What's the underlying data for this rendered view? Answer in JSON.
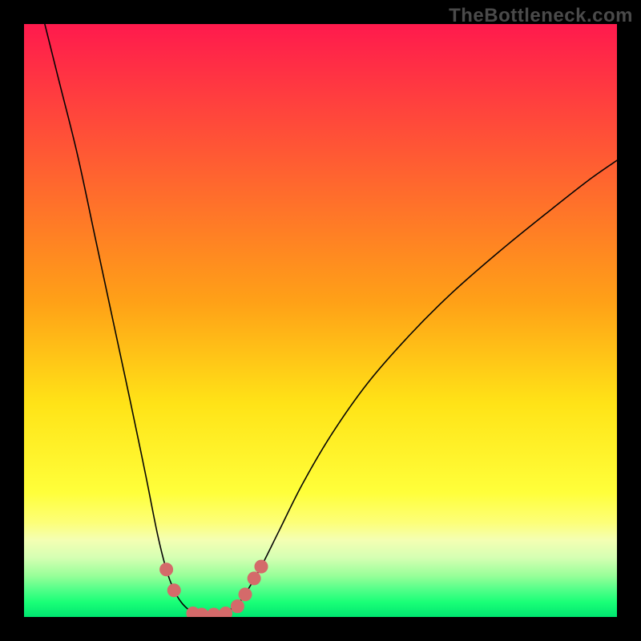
{
  "watermark": "TheBottleneck.com",
  "colors": {
    "frame_bg": "#000000",
    "watermark": "#4a4a4a",
    "curve": "#050505",
    "curve_stroke_w": 1.6,
    "marker_fill": "#d46a6a",
    "marker_stroke": "#d46a6a",
    "gradient_stops": [
      {
        "offset": 0.0,
        "color": "#ff1a4d"
      },
      {
        "offset": 0.47,
        "color": "#ffa117"
      },
      {
        "offset": 0.64,
        "color": "#ffe317"
      },
      {
        "offset": 0.79,
        "color": "#ffff3a"
      },
      {
        "offset": 0.84,
        "color": "#fdff77"
      },
      {
        "offset": 0.87,
        "color": "#f4ffb3"
      },
      {
        "offset": 0.9,
        "color": "#d5ffb3"
      },
      {
        "offset": 0.93,
        "color": "#99ff99"
      },
      {
        "offset": 0.955,
        "color": "#4fff88"
      },
      {
        "offset": 0.975,
        "color": "#1aff77"
      },
      {
        "offset": 1.0,
        "color": "#00e670"
      }
    ]
  },
  "chart_data": {
    "type": "line",
    "title": "",
    "xlabel": "",
    "ylabel": "",
    "xlim": [
      0,
      1
    ],
    "ylim": [
      0,
      1
    ],
    "curve": [
      {
        "x": 0.035,
        "y": 1.0
      },
      {
        "x": 0.06,
        "y": 0.9
      },
      {
        "x": 0.09,
        "y": 0.78
      },
      {
        "x": 0.12,
        "y": 0.64
      },
      {
        "x": 0.15,
        "y": 0.5
      },
      {
        "x": 0.18,
        "y": 0.36
      },
      {
        "x": 0.205,
        "y": 0.24
      },
      {
        "x": 0.225,
        "y": 0.14
      },
      {
        "x": 0.24,
        "y": 0.08
      },
      {
        "x": 0.253,
        "y": 0.045
      },
      {
        "x": 0.265,
        "y": 0.025
      },
      {
        "x": 0.278,
        "y": 0.012
      },
      {
        "x": 0.29,
        "y": 0.006
      },
      {
        "x": 0.305,
        "y": 0.004
      },
      {
        "x": 0.32,
        "y": 0.004
      },
      {
        "x": 0.335,
        "y": 0.007
      },
      {
        "x": 0.35,
        "y": 0.014
      },
      {
        "x": 0.365,
        "y": 0.027
      },
      {
        "x": 0.38,
        "y": 0.05
      },
      {
        "x": 0.4,
        "y": 0.085
      },
      {
        "x": 0.43,
        "y": 0.145
      },
      {
        "x": 0.47,
        "y": 0.225
      },
      {
        "x": 0.52,
        "y": 0.31
      },
      {
        "x": 0.58,
        "y": 0.395
      },
      {
        "x": 0.65,
        "y": 0.475
      },
      {
        "x": 0.72,
        "y": 0.545
      },
      {
        "x": 0.8,
        "y": 0.615
      },
      {
        "x": 0.88,
        "y": 0.68
      },
      {
        "x": 0.95,
        "y": 0.735
      },
      {
        "x": 1.0,
        "y": 0.77
      }
    ],
    "markers": [
      {
        "x": 0.24,
        "y": 0.08
      },
      {
        "x": 0.253,
        "y": 0.045
      },
      {
        "x": 0.285,
        "y": 0.006
      },
      {
        "x": 0.3,
        "y": 0.004
      },
      {
        "x": 0.32,
        "y": 0.004
      },
      {
        "x": 0.34,
        "y": 0.006
      },
      {
        "x": 0.36,
        "y": 0.018
      },
      {
        "x": 0.373,
        "y": 0.038
      },
      {
        "x": 0.388,
        "y": 0.065
      },
      {
        "x": 0.4,
        "y": 0.085
      }
    ],
    "marker_radius_px": 8
  }
}
